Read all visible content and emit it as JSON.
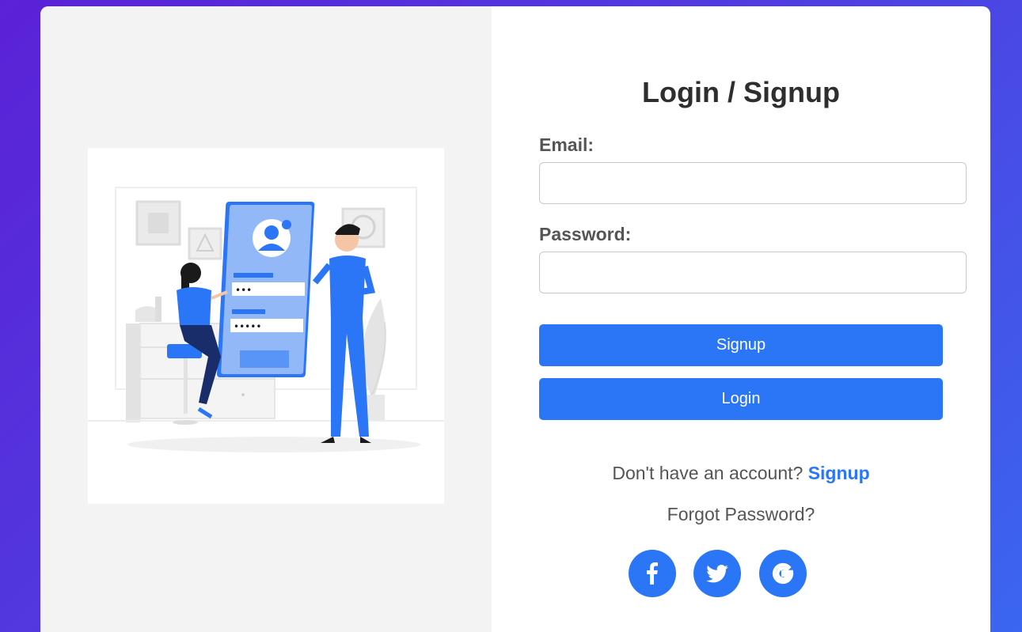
{
  "form": {
    "title": "Login / Signup",
    "email_label": "Email:",
    "email_value": "",
    "email_placeholder": "",
    "password_label": "Password:",
    "password_value": "",
    "password_placeholder": "",
    "signup_button": "Signup",
    "login_button": "Login",
    "account_prompt": "Don't have an account?",
    "account_link": "Signup",
    "forgot_password": "Forgot Password?"
  },
  "illustration": {
    "password_dots_1": "•••",
    "password_dots_2": "•••••"
  },
  "social": [
    {
      "name": "facebook",
      "icon": "facebook-icon"
    },
    {
      "name": "twitter",
      "icon": "twitter-icon"
    },
    {
      "name": "google",
      "icon": "google-icon"
    }
  ],
  "colors": {
    "accent": "#2a76f6",
    "background_gradient_start": "#5b21d6",
    "background_gradient_end": "#3a66f0",
    "left_panel": "#f3f3f3",
    "text": "#555555",
    "title": "#2e2e2e"
  }
}
